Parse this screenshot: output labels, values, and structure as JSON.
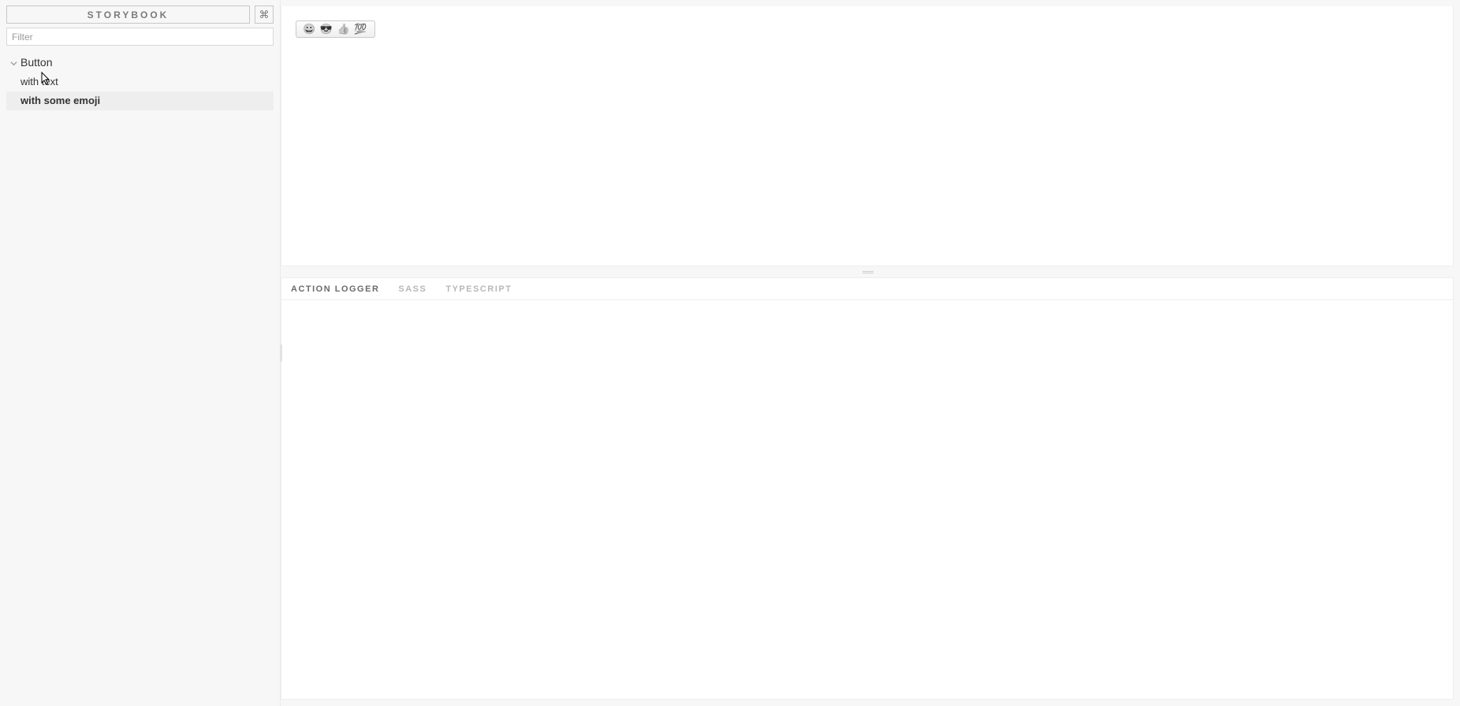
{
  "sidebar": {
    "brand_label": "STORYBOOK",
    "shortcut_label": "⌘",
    "filter_placeholder": "Filter",
    "filter_value": "",
    "groups": [
      {
        "label": "Button",
        "expanded": true,
        "stories": [
          {
            "label": "with text",
            "selected": false
          },
          {
            "label": "with some emoji",
            "selected": true
          }
        ]
      }
    ]
  },
  "preview": {
    "emoji_button_label": "😀 😎 👍 💯"
  },
  "addons": {
    "tabs": [
      {
        "label": "ACTION LOGGER",
        "active": true
      },
      {
        "label": "SASS",
        "active": false
      },
      {
        "label": "TYPESCRIPT",
        "active": false
      }
    ]
  }
}
